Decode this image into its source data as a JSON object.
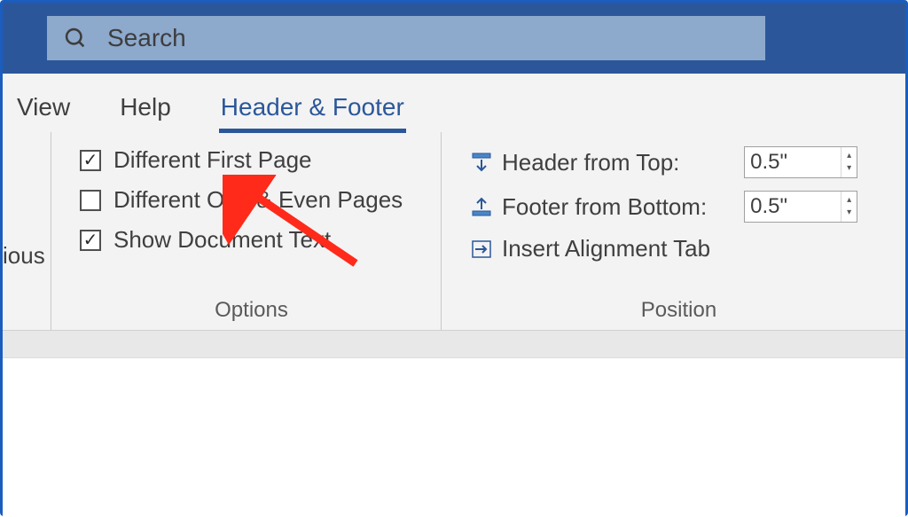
{
  "search": {
    "placeholder": "Search"
  },
  "tabs": {
    "view": "View",
    "help": "Help",
    "hf": "Header & Footer"
  },
  "leftcut": "ious",
  "options": {
    "group_label": "Options",
    "diff_first": "Different First Page",
    "diff_oe": "Different Odd & Even Pages",
    "show_doc": "Show Document Text",
    "diff_first_checked": true,
    "diff_oe_checked": false,
    "show_doc_checked": true
  },
  "position": {
    "group_label": "Position",
    "header_top": "Header from Top:",
    "footer_bottom": "Footer from Bottom:",
    "insert_tab": "Insert Alignment Tab",
    "header_val": "0.5\"",
    "footer_val": "0.5\""
  }
}
